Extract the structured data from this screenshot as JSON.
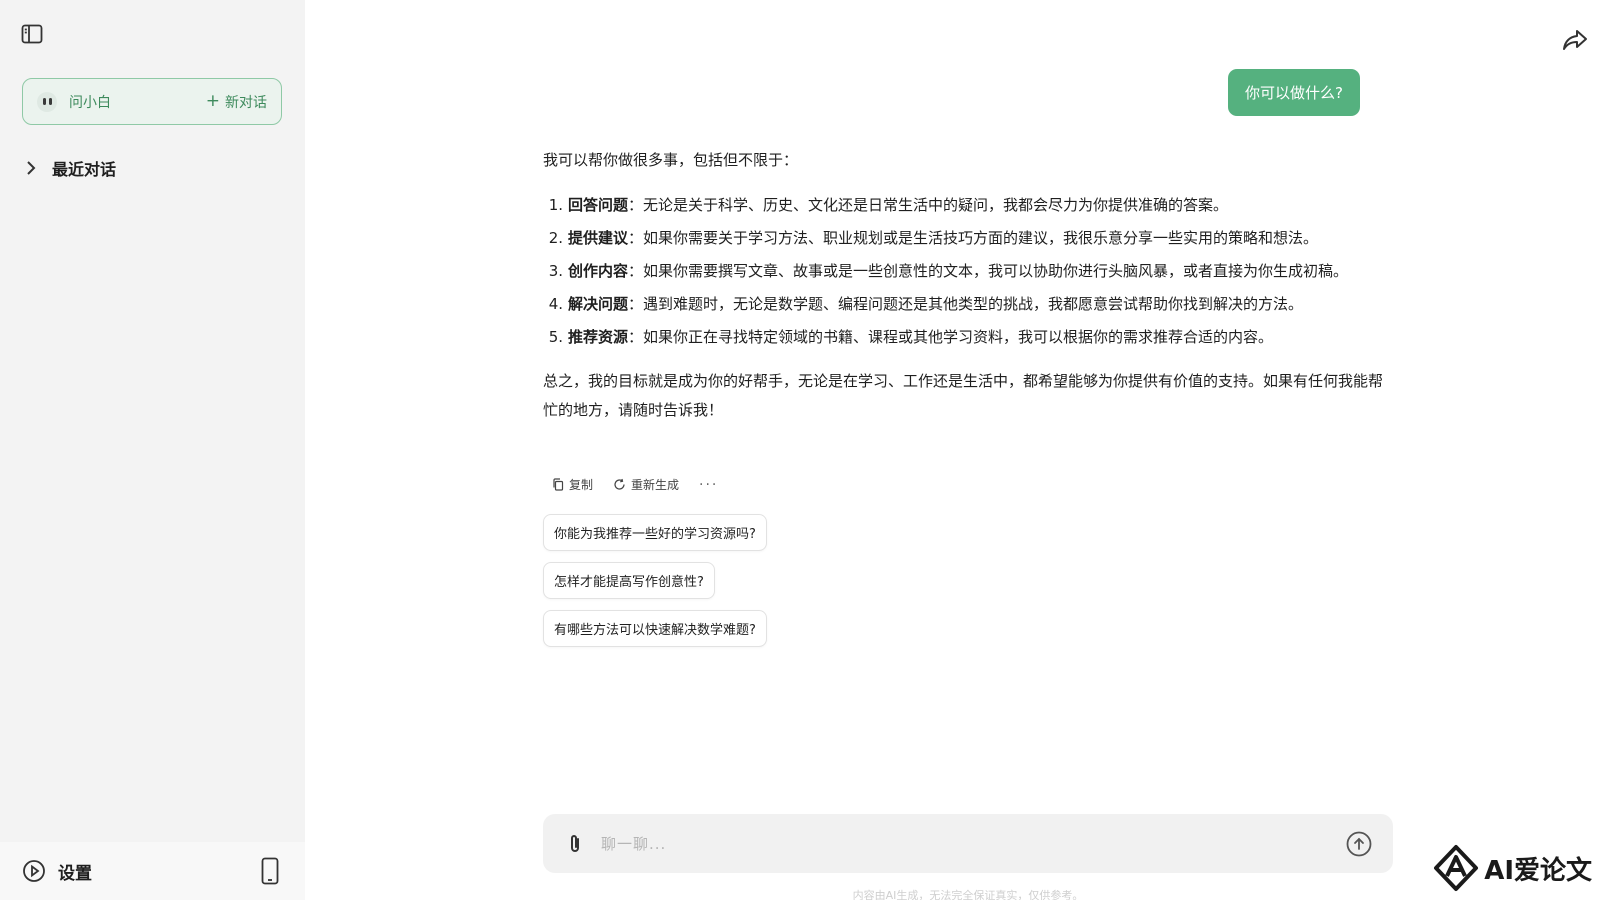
{
  "sidebar": {
    "assistant_name": "问小白",
    "new_chat_label": "新对话",
    "recent_label": "最近对话",
    "settings_label": "设置"
  },
  "chat": {
    "user_message": "你可以做什么?",
    "answer_intro": "我可以帮你做很多事，包括但不限于：",
    "answer_items": [
      {
        "num": "1.",
        "title": "回答问题",
        "text": "：无论是关于科学、历史、文化还是日常生活中的疑问，我都会尽力为你提供准确的答案。"
      },
      {
        "num": "2.",
        "title": "提供建议",
        "text": "：如果你需要关于学习方法、职业规划或是生活技巧方面的建议，我很乐意分享一些实用的策略和想法。"
      },
      {
        "num": "3.",
        "title": "创作内容",
        "text": "：如果你需要撰写文章、故事或是一些创意性的文本，我可以协助你进行头脑风暴，或者直接为你生成初稿。"
      },
      {
        "num": "4.",
        "title": "解决问题",
        "text": "：遇到难题时，无论是数学题、编程问题还是其他类型的挑战，我都愿意尝试帮助你找到解决的方法。"
      },
      {
        "num": "5.",
        "title": "推荐资源",
        "text": "：如果你正在寻找特定领域的书籍、课程或其他学习资料，我可以根据你的需求推荐合适的内容。"
      }
    ],
    "answer_outro": "总之，我的目标就是成为你的好帮手，无论是在学习、工作还是生活中，都希望能够为你提供有价值的支持。如果有任何我能帮忙的地方，请随时告诉我！",
    "actions": {
      "copy": "复制",
      "regenerate": "重新生成",
      "more": "···"
    },
    "suggestions": [
      "你能为我推荐一些好的学习资源吗?",
      "怎样才能提高写作创意性?",
      "有哪些方法可以快速解决数学难题?"
    ]
  },
  "input": {
    "placeholder": "聊一聊...",
    "disclaimer": "内容由AI生成，无法完全保证真实，仅供参考。"
  },
  "watermark": {
    "text": "AI爱论文"
  },
  "colors": {
    "accent": "#55b17f",
    "accent_text": "#3d8a5c",
    "sidebar_bg": "#f3f3f3"
  }
}
